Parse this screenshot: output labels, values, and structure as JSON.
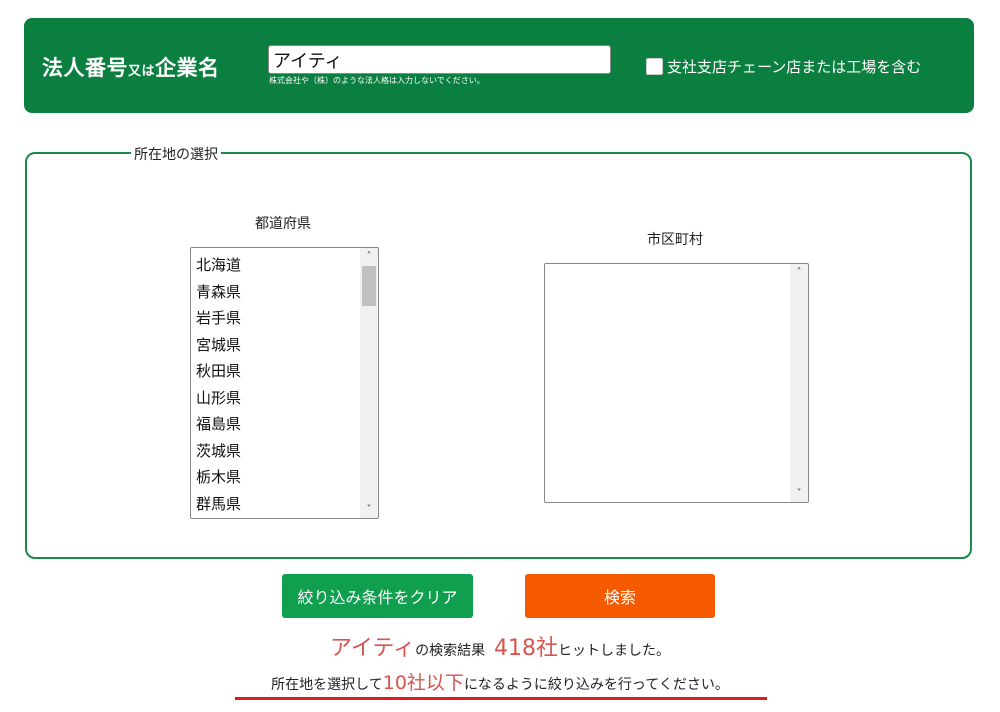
{
  "search": {
    "title_main": "法人番号",
    "title_small": "又は",
    "title_end": "企業名",
    "input_value": "アイティ",
    "input_note": "株式会社や（株）のような法人格は入力しないでください。",
    "branch_checkbox_label": "支社支店チェーン店または工場を含む"
  },
  "location": {
    "legend": "所在地の選択",
    "prefecture_label": "都道府県",
    "city_label": "市区町村",
    "prefectures": [
      "北海道",
      "青森県",
      "岩手県",
      "宮城県",
      "秋田県",
      "山形県",
      "福島県",
      "茨城県",
      "栃木県",
      "群馬県"
    ]
  },
  "buttons": {
    "clear_label": "絞り込み条件をクリア",
    "search_label": "検索"
  },
  "result": {
    "query": "アイティ",
    "middle": "の検索結果",
    "count": "418社",
    "suffix": "ヒットしました。",
    "notice_pre": "所在地を選択して",
    "notice_highlight": "10社以下",
    "notice_post": "になるように絞り込みを行ってください。"
  },
  "colors": {
    "header_green": "#0b7f3f",
    "border_green": "#1a8a4a",
    "clear_button": "#109f4e",
    "search_button": "#f55a00",
    "highlight_red": "#d9534f",
    "underline_red": "#e21b1b"
  },
  "icons": {
    "scroll_up": "chevron-up-icon",
    "scroll_down": "chevron-down-icon"
  }
}
